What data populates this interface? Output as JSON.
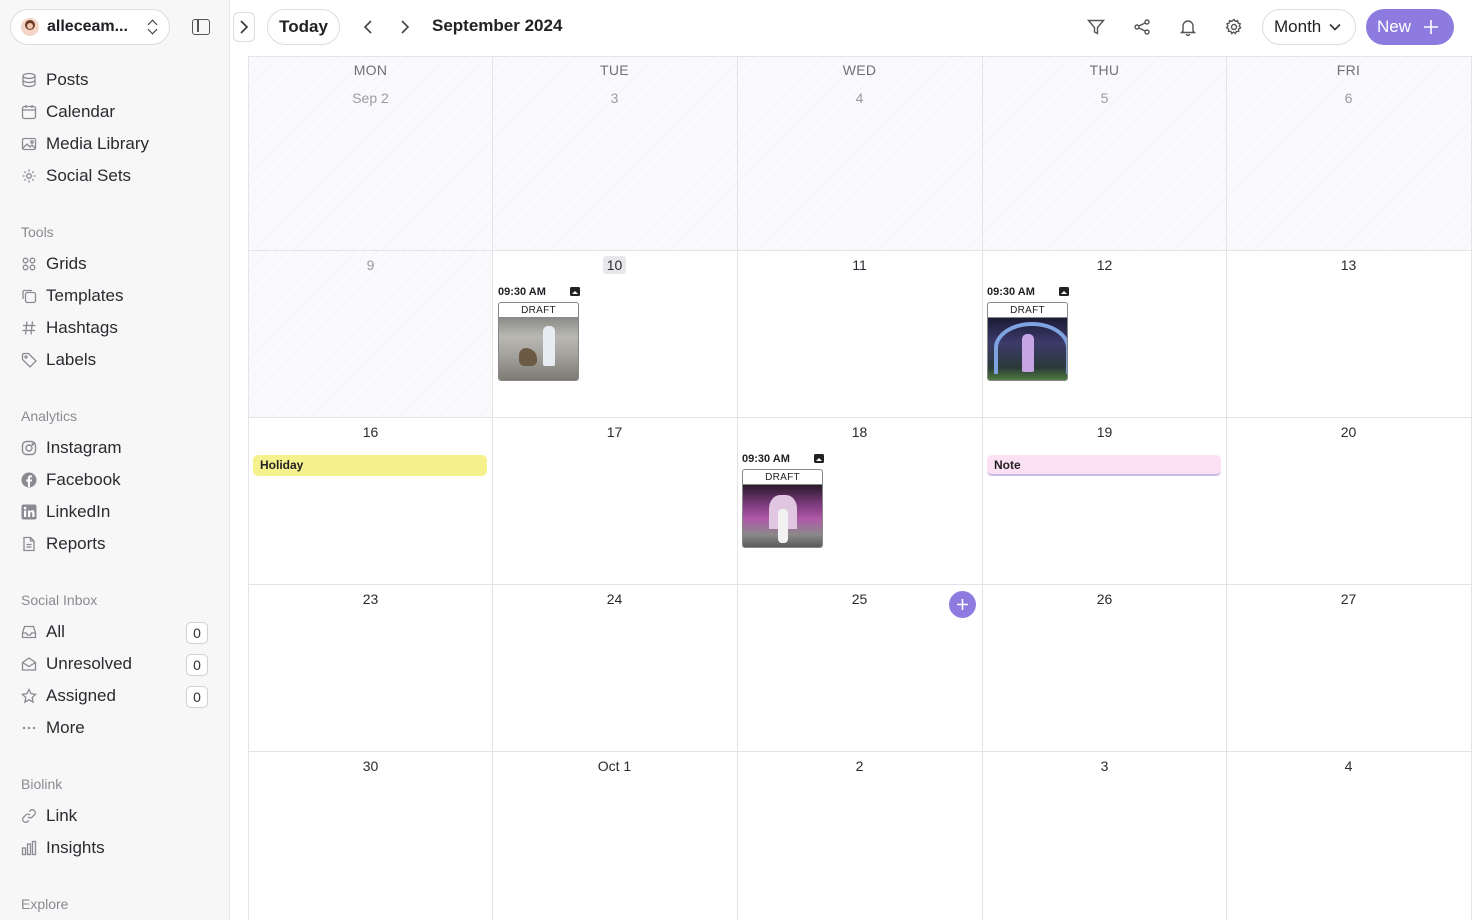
{
  "account": {
    "name": "alleceam..."
  },
  "sidebar": {
    "main_items": [
      {
        "label": "Posts",
        "icon": "stack-icon"
      },
      {
        "label": "Calendar",
        "icon": "calendar-icon"
      },
      {
        "label": "Media Library",
        "icon": "image-icon"
      },
      {
        "label": "Social Sets",
        "icon": "gear-icon"
      }
    ],
    "tools": {
      "title": "Tools",
      "items": [
        {
          "label": "Grids",
          "icon": "grid-icon"
        },
        {
          "label": "Templates",
          "icon": "copy-icon"
        },
        {
          "label": "Hashtags",
          "icon": "hash-icon"
        },
        {
          "label": "Labels",
          "icon": "tag-icon"
        }
      ]
    },
    "analytics": {
      "title": "Analytics",
      "items": [
        {
          "label": "Instagram",
          "icon": "instagram-icon"
        },
        {
          "label": "Facebook",
          "icon": "facebook-icon"
        },
        {
          "label": "LinkedIn",
          "icon": "linkedin-icon"
        },
        {
          "label": "Reports",
          "icon": "document-icon"
        }
      ]
    },
    "inbox": {
      "title": "Social Inbox",
      "items": [
        {
          "label": "All",
          "icon": "inbox-icon",
          "count": "0"
        },
        {
          "label": "Unresolved",
          "icon": "envelope-open-icon",
          "count": "0"
        },
        {
          "label": "Assigned",
          "icon": "star-icon",
          "count": "0"
        },
        {
          "label": "More",
          "icon": "ellipsis-icon"
        }
      ]
    },
    "biolink": {
      "title": "Biolink",
      "items": [
        {
          "label": "Link",
          "icon": "link-icon"
        },
        {
          "label": "Insights",
          "icon": "bar-chart-icon"
        }
      ]
    },
    "explore": {
      "title": "Explore"
    }
  },
  "topbar": {
    "today_label": "Today",
    "month_title": "September 2024",
    "view_label": "Month",
    "new_label": "New"
  },
  "calendar": {
    "weekdays": [
      "MON",
      "TUE",
      "WED",
      "THU",
      "FRI"
    ],
    "weeks": [
      [
        "Sep 2",
        "3",
        "4",
        "5",
        "6"
      ],
      [
        "9",
        "10",
        "11",
        "12",
        "13"
      ],
      [
        "16",
        "17",
        "18",
        "19",
        "20"
      ],
      [
        "23",
        "24",
        "25",
        "26",
        "27"
      ],
      [
        "30",
        "Oct 1",
        "2",
        "3",
        "4"
      ]
    ],
    "posts": [
      {
        "time": "09:30 AM",
        "status": "DRAFT"
      },
      {
        "time": "09:30 AM",
        "status": "DRAFT"
      },
      {
        "time": "09:30 AM",
        "status": "DRAFT"
      }
    ],
    "events": {
      "holiday": "Holiday",
      "note": "Note"
    }
  },
  "colors": {
    "accent": "#8d7be0",
    "holiday": "#f5f18c",
    "note": "#fbe1f3"
  }
}
